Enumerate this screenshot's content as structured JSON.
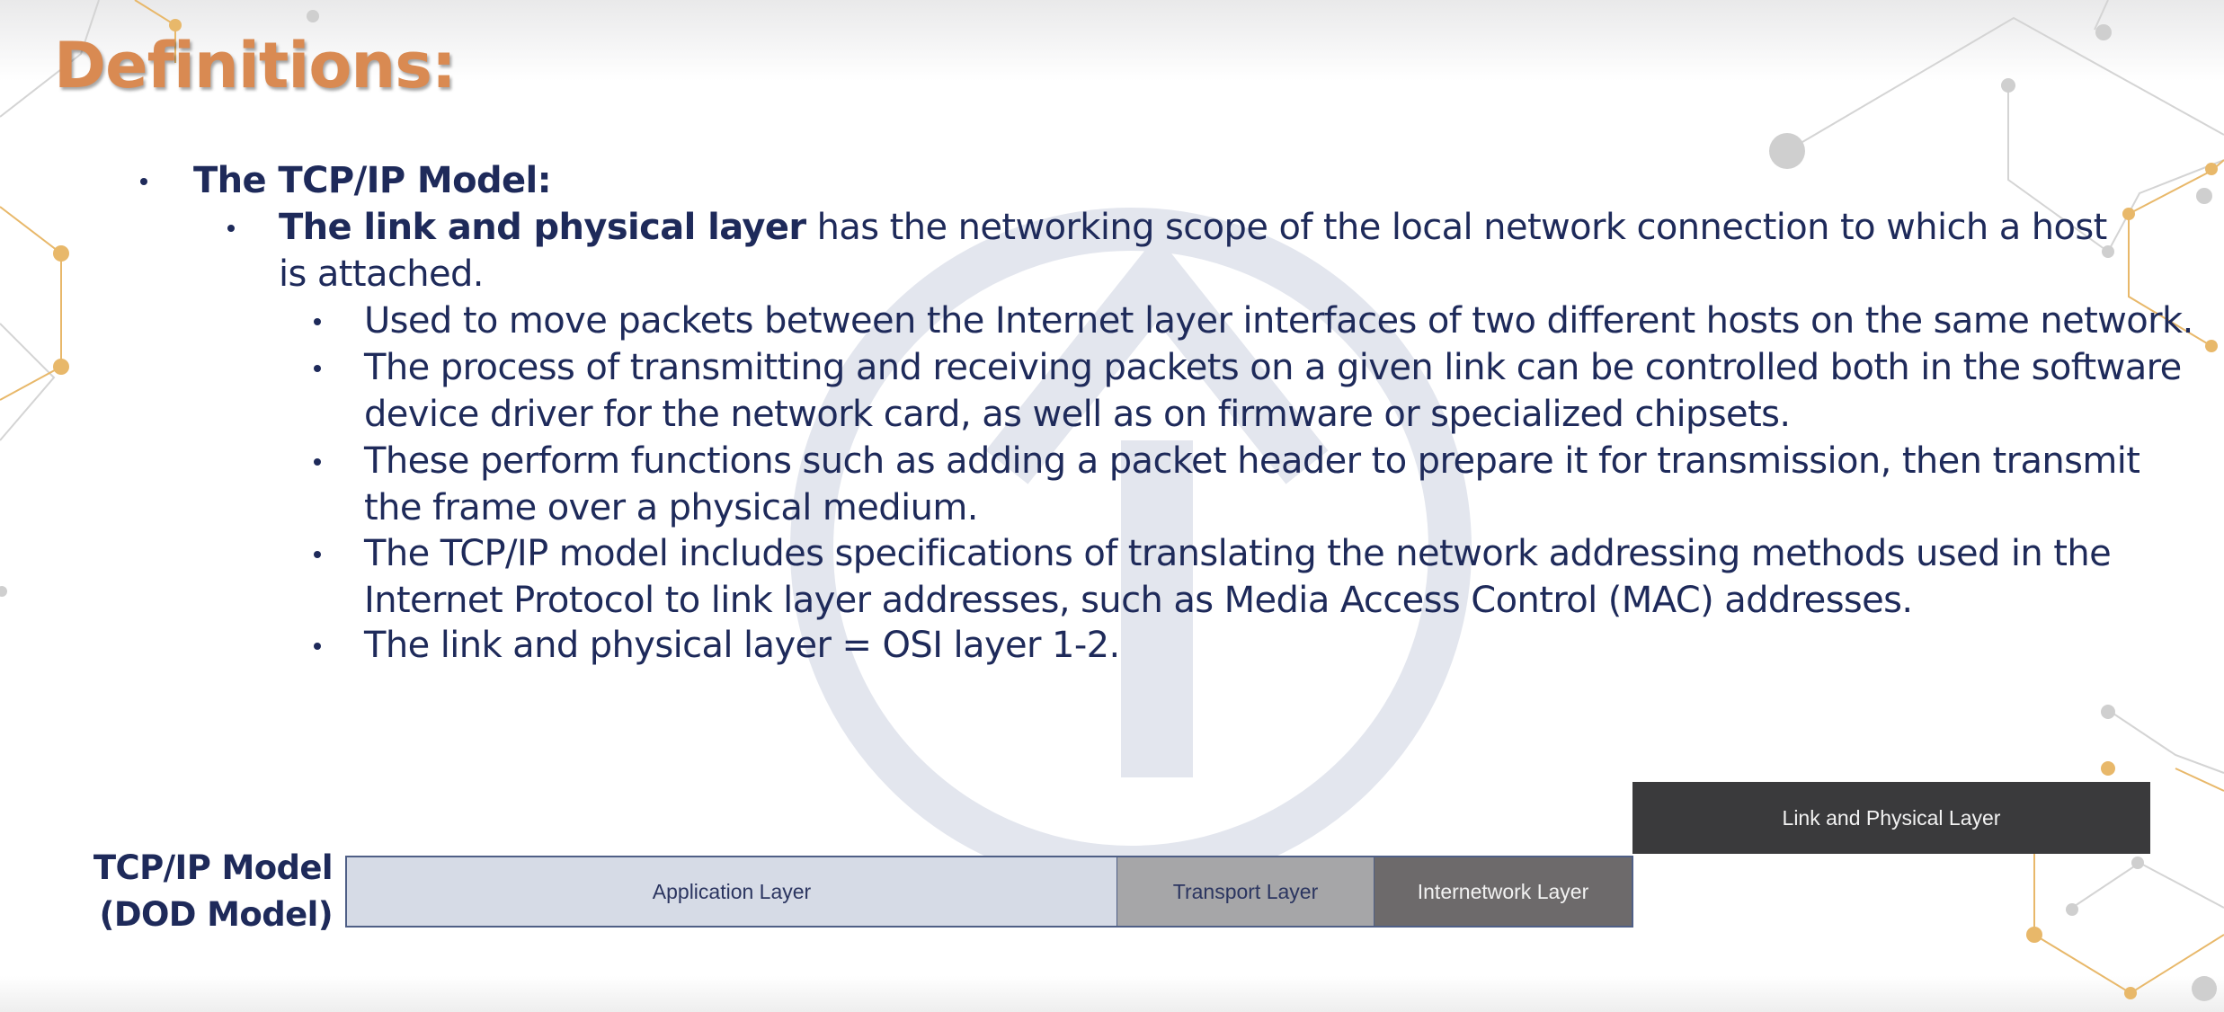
{
  "slide": {
    "title": "Definitions:",
    "bullet_1": {
      "label": "The TCP/IP Model:"
    },
    "bullet_2": {
      "bold": "The link and physical layer",
      "rest": " has the networking scope of the local network connection to which a host is attached."
    },
    "sub_bullets": [
      "Used to move packets between the Internet layer interfaces of two different hosts on the same network.",
      "The process of transmitting and receiving packets on a given link can be controlled both in the software device driver for the network card, as well as on firmware or specialized chipsets.",
      "These perform functions such as adding a packet header to prepare it for transmission, then transmit the frame over a physical medium.",
      "The TCP/IP model includes specifications of translating the network addressing methods used in the Internet Protocol to link layer addresses, such as Media Access Control (MAC) addresses.",
      "The link and physical layer = OSI layer 1-2."
    ]
  },
  "diagram": {
    "label_line1": "TCP/IP Model",
    "label_line2": "(DOD Model)",
    "layers": {
      "application": "Application Layer",
      "transport": "Transport Layer",
      "internetwork": "Internetwork Layer",
      "link_physical": "Link and Physical Layer"
    }
  },
  "colors": {
    "title": "#d98a52",
    "text": "#1e2a5a",
    "application_fill": "#d6dbe6",
    "transport_fill": "#a6a6a8",
    "internetwork_fill": "#6d6a6b",
    "link_fill": "#3a3a3c",
    "watermark": "#e3e6ee",
    "network_gold": "#e8b86a",
    "network_grey": "#c8c8c8"
  },
  "icons": [
    "watermark-logo",
    "network-decoration"
  ]
}
